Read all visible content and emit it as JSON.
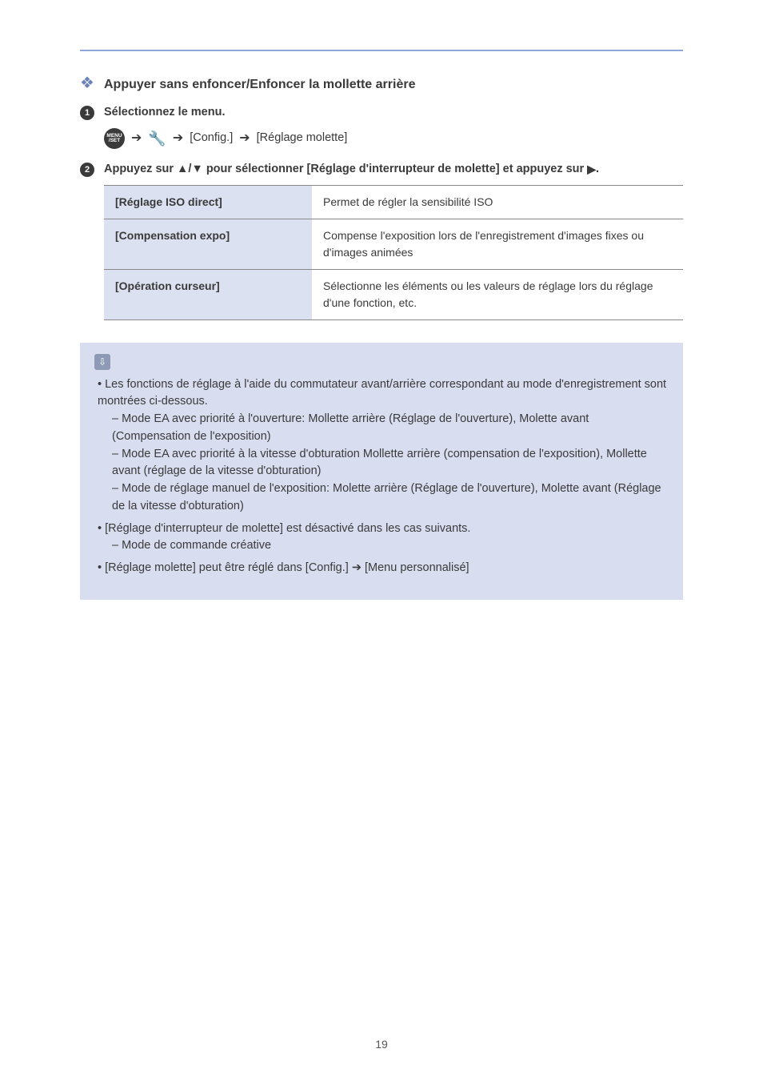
{
  "section_title": "Appuyer sans enfoncer/Enfoncer la mollette arrière",
  "step1": {
    "label": "Sélectionnez le menu.",
    "menu": {
      "setup": "[Config.]",
      "dial_set": "[Réglage molette]"
    }
  },
  "step2": {
    "prefix": "Appuyez sur ",
    "mid": "/",
    "suffix": " pour sélectionner [Réglage d'interrupteur de molette] et appuyez sur ",
    "end": "."
  },
  "table": {
    "rows": [
      {
        "k": "[Réglage ISO direct]",
        "v": "Permet de régler la sensibilité ISO"
      },
      {
        "k": "[Compensation expo]",
        "v": "Compense l'exposition lors de l'enregistrement d'images fixes ou d'images animées"
      },
      {
        "k": "[Opération curseur]",
        "v": "Sélectionne les éléments ou les valeurs de réglage lors du réglage d'une fonction, etc."
      }
    ]
  },
  "notes": {
    "n1": "Les fonctions de réglage à l'aide du commutateur avant/arrière correspondant au mode d'enregistrement sont montrées ci-dessous.",
    "n1_subs": [
      "Mode EA avec priorité à l'ouverture: Mollette arrière (Réglage de l'ouverture), Molette avant (Compensation de l'exposition)",
      "Mode EA avec priorité à la vitesse d'obturation Mollette arrière (compensation de l'exposition), Mollette avant (réglage de la vitesse d'obturation)",
      "Mode de réglage manuel de l'exposition: Molette arrière (Réglage de l'ouverture), Molette avant (Réglage de la vitesse d'obturation)"
    ],
    "n2": "[Réglage d'interrupteur de molette] est désactivé dans les cas suivants.",
    "n2_subs": [
      "Mode de commande créative"
    ],
    "n3_prefix": "[Réglage molette] peut être réglé dans [Config.] ",
    "n3_suffix": " [Menu personnalisé]"
  },
  "page_number": "19"
}
